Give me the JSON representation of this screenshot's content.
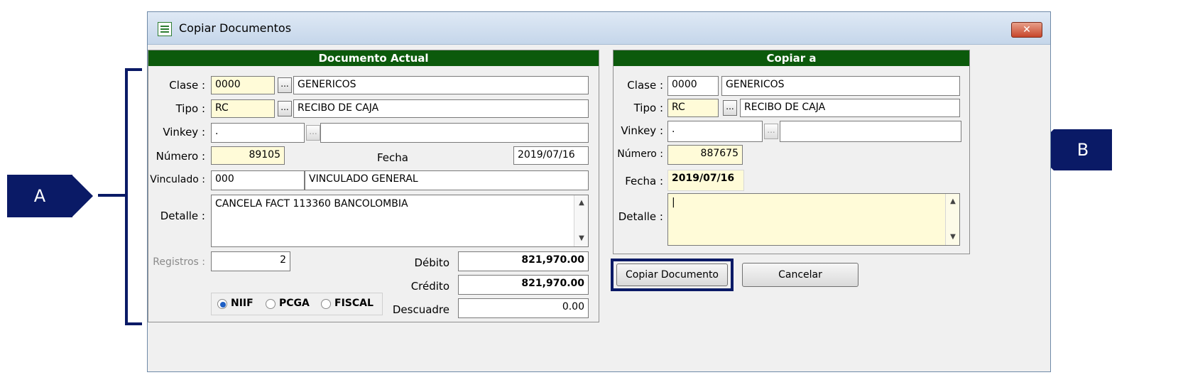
{
  "window": {
    "title": "Copiar Documentos",
    "close_symbol": "✕"
  },
  "left_panel": {
    "header": "Documento Actual",
    "clase": {
      "label": "Clase :",
      "code": "0000",
      "name": "GENERICOS"
    },
    "tipo": {
      "label": "Tipo :",
      "code": "RC",
      "name": "RECIBO DE CAJA"
    },
    "vinkey": {
      "label": "Vinkey :",
      "code": ".",
      "name": ""
    },
    "numero": {
      "label": "Número :",
      "value": "89105"
    },
    "fecha": {
      "label": "Fecha",
      "value": "2019/07/16"
    },
    "vinculado": {
      "label": "Vinculado :",
      "code": "000",
      "name": "VINCULADO GENERAL"
    },
    "detalle": {
      "label": "Detalle :",
      "value": "CANCELA FACT 113360 BANCOLOMBIA"
    },
    "registros": {
      "label": "Registros :",
      "value": "2"
    },
    "debito": {
      "label": "Débito",
      "value": "821,970.00"
    },
    "credito": {
      "label": "Crédito",
      "value": "821,970.00"
    },
    "descuadre": {
      "label": "Descuadre",
      "value": "0.00"
    },
    "radios": [
      {
        "label": "NIIF",
        "checked": true
      },
      {
        "label": "PCGA",
        "checked": false
      },
      {
        "label": "FISCAL",
        "checked": false
      }
    ]
  },
  "right_panel": {
    "header": "Copiar a",
    "clase": {
      "label": "Clase :",
      "code": "0000",
      "name": "GENERICOS"
    },
    "tipo": {
      "label": "Tipo :",
      "code": "RC",
      "name": "RECIBO DE CAJA"
    },
    "vinkey": {
      "label": "Vinkey :",
      "code": ".",
      "name": ""
    },
    "numero": {
      "label": "Número :",
      "value": "887675"
    },
    "fecha": {
      "label": "Fecha :",
      "value": "2019/07/16"
    },
    "detalle": {
      "label": "Detalle :",
      "value": "|"
    }
  },
  "buttons": {
    "copy": "Copiar Documento",
    "cancel": "Cancelar"
  },
  "ellipsis": "...",
  "scroll_up": "▲",
  "scroll_down": "▼",
  "callouts": {
    "a": "A",
    "b": "B"
  },
  "colors": {
    "header_green": "#0c5a0c",
    "annotation_navy": "#0a1a66",
    "field_yellow": "#fffbd8"
  }
}
